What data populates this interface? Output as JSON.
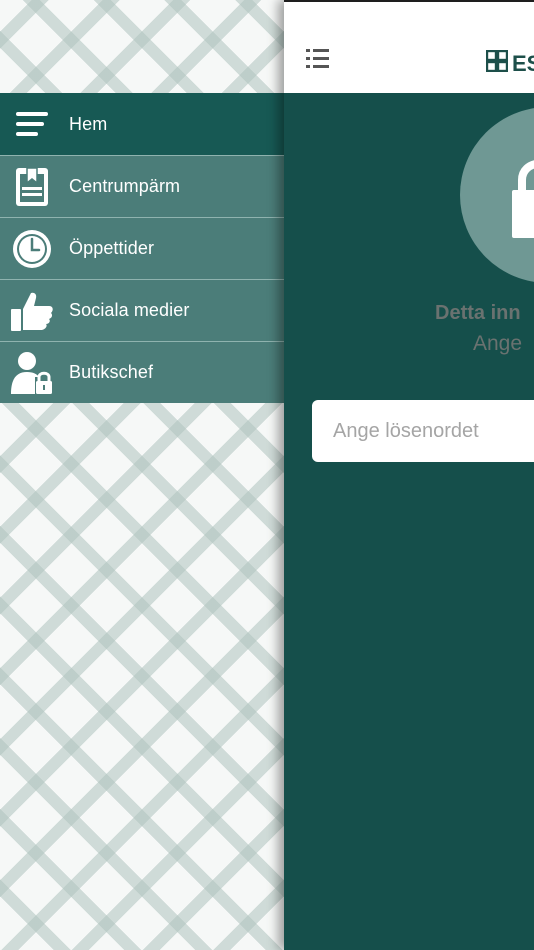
{
  "drawer": {
    "items": [
      {
        "label": "Hem",
        "icon": "hamburger-icon",
        "active": true
      },
      {
        "label": "Centrumpärm",
        "icon": "binder-icon",
        "active": false
      },
      {
        "label": "Öppettider",
        "icon": "clock-icon",
        "active": false
      },
      {
        "label": "Sociala medier",
        "icon": "thumbs-up-icon",
        "active": false
      },
      {
        "label": "Butikschef",
        "icon": "manager-lock-icon",
        "active": false
      }
    ]
  },
  "header": {
    "list_icon": "list-icon",
    "brand_logo": "grid-logo-icon",
    "brand_text": "ES"
  },
  "main": {
    "lock_icon": "lock-icon",
    "info_title": "Detta inn",
    "info_subtitle": "Ange",
    "password_placeholder": "Ange lösenordet",
    "password_value": ""
  },
  "colors": {
    "drawer_item": "#4b7d79",
    "drawer_item_active": "#175954",
    "main_background": "#154f4b",
    "lock_circle": "#6f9894",
    "muted_text": "#6a7270"
  }
}
